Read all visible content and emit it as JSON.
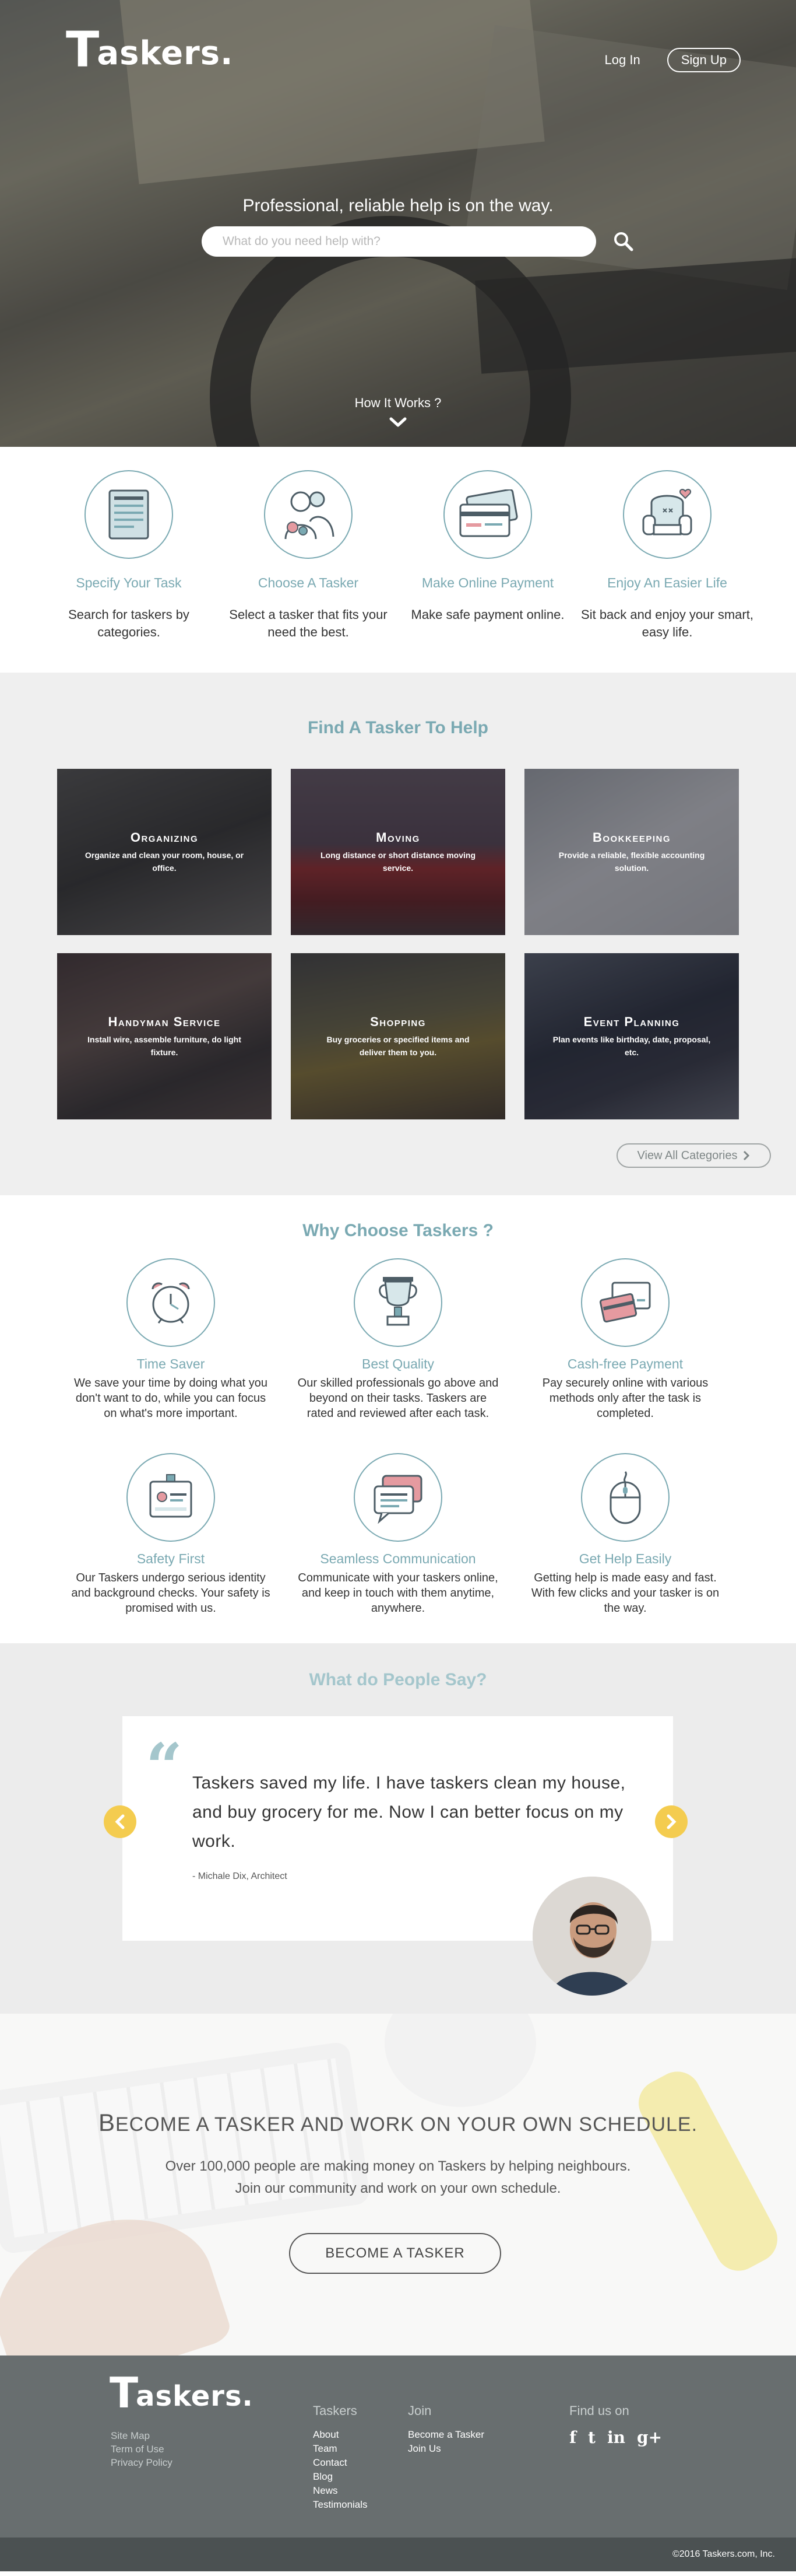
{
  "brand": {
    "logo_big": "T",
    "logo_rest": "askers."
  },
  "nav": {
    "login": "Log In",
    "signup": "Sign Up"
  },
  "hero": {
    "tagline": "Professional, reliable help is on the way.",
    "search_placeholder": "What do you need help with?",
    "how_it_works": "How It Works ?"
  },
  "steps": [
    {
      "icon": "document-icon",
      "title": "Specify Your Task",
      "desc": "Search for taskers by categories."
    },
    {
      "icon": "people-icon",
      "title": "Choose A Tasker",
      "desc": "Select a tasker that fits your need the best."
    },
    {
      "icon": "credit-card-icon",
      "title": "Make Online Payment",
      "desc": "Make safe payment online."
    },
    {
      "icon": "armchair-icon",
      "title": "Enjoy An Easier Life",
      "desc": "Sit back and enjoy your smart, easy life."
    }
  ],
  "find": {
    "title": "Find A Tasker To Help",
    "categories": [
      {
        "title": "Organizing",
        "desc": "Organize and clean your room, house, or office."
      },
      {
        "title": "Moving",
        "desc": "Long distance or short distance moving service."
      },
      {
        "title": "Bookkeeping",
        "desc": "Provide a reliable, flexible accounting solution."
      },
      {
        "title": "Handyman Service",
        "desc": "Install wire, assemble furniture, do light fixture."
      },
      {
        "title": "Shopping",
        "desc": "Buy groceries or specified items and deliver them to you."
      },
      {
        "title": "Event Planning",
        "desc": "Plan events like birthday, date, proposal, etc."
      }
    ],
    "view_all": "View All Categories"
  },
  "why": {
    "title": "Why Choose Taskers ?",
    "features": [
      {
        "icon": "alarm-clock-icon",
        "title": "Time Saver",
        "desc": "We save your time by doing what you don't want to do, while you can focus on what's more important."
      },
      {
        "icon": "trophy-icon",
        "title": "Best Quality",
        "desc": "Our skilled professionals go above and beyond on their tasks. Taskers are rated and reviewed after each task."
      },
      {
        "icon": "cards-icon",
        "title": "Cash-free Payment",
        "desc": "Pay securely online with various methods only after the task is completed."
      },
      {
        "icon": "id-badge-icon",
        "title": "Safety First",
        "desc": "Our Taskers undergo serious identity and background checks. Your safety is promised with us."
      },
      {
        "icon": "chat-bubbles-icon",
        "title": "Seamless Communication",
        "desc": "Communicate with your taskers online, and keep in touch  with them anytime, anywhere."
      },
      {
        "icon": "mouse-icon",
        "title": "Get Help Easily",
        "desc": "Getting help is made easy and fast. With few clicks and your tasker is on the way."
      }
    ]
  },
  "testimonials": {
    "title": "What do People Say?",
    "quote": "Taskers saved my life. I have taskers clean my house, and buy grocery for me. Now I can better focus on my work.",
    "author": "- Michale Dix, Architect"
  },
  "become": {
    "title_cap1": "B",
    "title_rest": "ECOME A TASKER AND WORK ON YOUR OWN SCHEDULE.",
    "line1": "Over 100,000 people are making money on Taskers by helping neighbours.",
    "line2": "Join our community and work on your own schedule.",
    "button": "BECOME A TASKER"
  },
  "footer": {
    "left_links": [
      "Site Map",
      "Term  of Use",
      "Privacy Policy"
    ],
    "taskers_title": "Taskers",
    "taskers_links": [
      "About",
      "Team",
      "Contact",
      "Blog",
      "News",
      "Testimonials"
    ],
    "join_title": "Join",
    "join_links": [
      "Become a Tasker",
      "Join Us"
    ],
    "find_title": "Find us on",
    "socials": [
      "f",
      "t",
      "in",
      "g+"
    ],
    "copyright": "©2016 Taskers.com, Inc."
  },
  "colors": {
    "accent": "#7aa9b2",
    "arrow": "#f4cc4f",
    "footer": "#686e6f",
    "footer_bar": "#4b5152"
  }
}
